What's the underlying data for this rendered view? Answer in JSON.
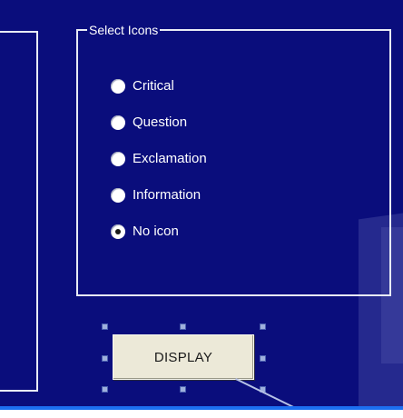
{
  "group": {
    "legend": "Select Icons"
  },
  "radios": [
    {
      "label": "Critical",
      "checked": false
    },
    {
      "label": "Question",
      "checked": false
    },
    {
      "label": "Exclamation",
      "checked": false
    },
    {
      "label": "Information",
      "checked": false
    },
    {
      "label": "No icon",
      "checked": true
    }
  ],
  "button": {
    "label": "DISPLAY"
  },
  "colors": {
    "background": "#0a0d7c",
    "frame": "#e8ebf5",
    "button_face": "#ece9d8"
  }
}
